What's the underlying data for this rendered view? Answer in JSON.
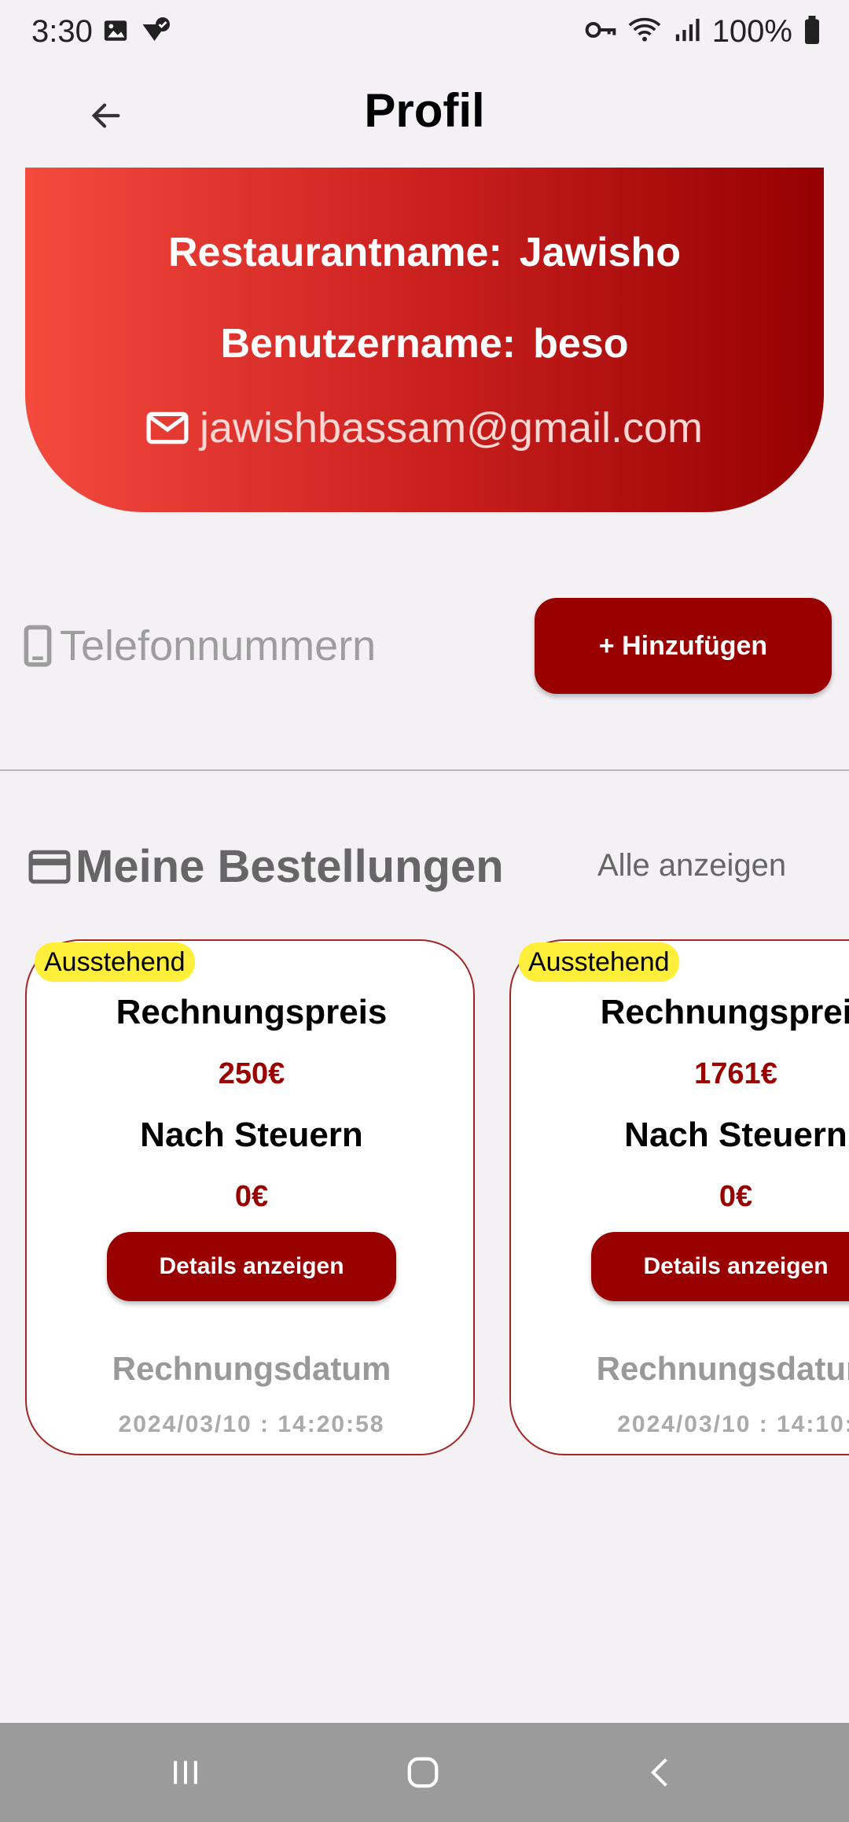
{
  "status_bar": {
    "time": "3:30",
    "battery": "100%"
  },
  "app_bar": {
    "title": "Profil"
  },
  "profile": {
    "restaurant_label": "Restaurantname:",
    "restaurant_value": "Jawisho",
    "username_label": "Benutzername:",
    "username_value": "beso",
    "email": "jawishbassam@gmail.com"
  },
  "phones": {
    "label": "Telefonnummern",
    "add_button": "+ Hinzufügen"
  },
  "orders": {
    "title": "Meine Bestellungen",
    "view_all": "Alle anzeigen",
    "cards": [
      {
        "status": "Ausstehend",
        "price_label": "Rechnungspreis",
        "price": "250€",
        "after_tax_label": "Nach Steuern",
        "after_tax": "0€",
        "details_button": "Details anzeigen",
        "date_label": "Rechnungsdatum",
        "date": "2024/03/10 : 14:20:58"
      },
      {
        "status": "Ausstehend",
        "price_label": "Rechnungspreis",
        "price": "1761€",
        "after_tax_label": "Nach Steuern",
        "after_tax": "0€",
        "details_button": "Details anzeigen",
        "date_label": "Rechnungsdatum",
        "date": "2024/03/10 : 14:10:"
      }
    ]
  },
  "colors": {
    "accent": "#990000",
    "badge": "#ffee3a",
    "background": "#f4f1f5"
  }
}
